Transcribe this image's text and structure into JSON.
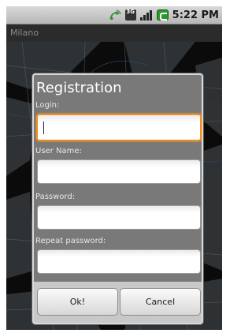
{
  "status_bar": {
    "time": "5:22 PM",
    "icons": [
      "phone-icon",
      "threeg-icon",
      "signal-icon",
      "battery-icon"
    ],
    "network_label": "3G"
  },
  "app": {
    "title": "Milano"
  },
  "dialog": {
    "title": "Registration",
    "fields": [
      {
        "label": "Login:",
        "value": "",
        "focused": true
      },
      {
        "label": "User Name:",
        "value": ""
      },
      {
        "label": "Password:",
        "value": ""
      },
      {
        "label": "Repeat password:",
        "value": ""
      }
    ],
    "buttons": {
      "ok": "Ok!",
      "cancel": "Cancel"
    }
  },
  "colors": {
    "focus": "#f48c1e",
    "battery": "#2a9a2a",
    "dialog_body": "#797979"
  }
}
